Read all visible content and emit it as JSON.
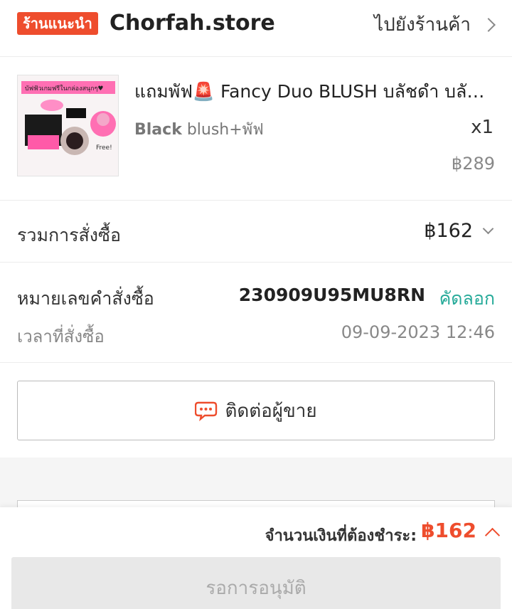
{
  "shop": {
    "badge": "ร้านแนะนำ",
    "name": "Chorfah.store",
    "goto_label": "ไปยังร้านค้า"
  },
  "product": {
    "title": "แถมพัฟ🚨 Fancy Duo BLUSH บลัชดำ บลัชออน",
    "variant_bold": "Black",
    "variant_rest": " blush+พัฟ",
    "qty": "x1",
    "price": "฿289",
    "image_banner": "บัฟฟัวเกมฟรีในกล่องสนุกๆ♥",
    "image_tag": "Free!"
  },
  "order_total": {
    "label": "รวมการสั่งซื้อ",
    "value": "฿162"
  },
  "order_info": {
    "number_label": "หมายเลขคำสั่งซื้อ",
    "number": "230909U95MU8RN",
    "copy_label": "คัดลอก",
    "time_label": "เวลาที่สั่งซื้อ",
    "time": "09-09-2023 12:46"
  },
  "contact": {
    "label": "ติดต่อผู้ขาย"
  },
  "footer": {
    "pay_label": "จำนวนเงินที่ต้องชำระ:",
    "pay_amount": "฿162",
    "await_label": "รอการอนุมัติ"
  },
  "colors": {
    "accent": "#ee4d2d",
    "copy": "#26aa99"
  }
}
